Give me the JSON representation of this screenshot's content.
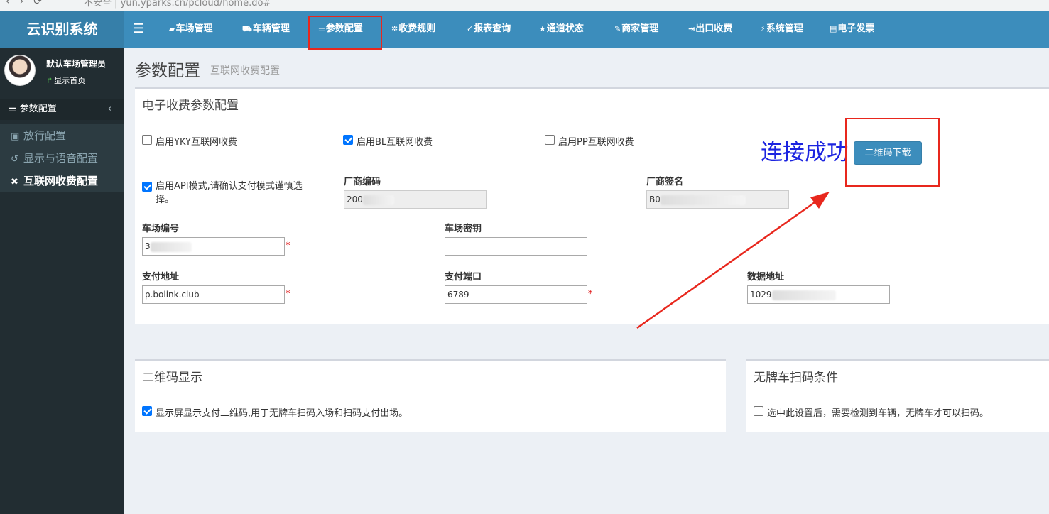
{
  "browser": {
    "url_text": "不安全 | yun.yparks.cn/pcloud/home.do#"
  },
  "header": {
    "logo": "云识别系统",
    "menu": [
      {
        "icon": "car-front-icon",
        "glyph": "▰",
        "label": "车场管理"
      },
      {
        "icon": "car-icon",
        "glyph": "⛟",
        "label": "车辆管理"
      },
      {
        "icon": "sliders-icon",
        "glyph": "⚌",
        "label": "参数配置"
      },
      {
        "icon": "cogs-icon",
        "glyph": "✲",
        "label": "收费规则"
      },
      {
        "icon": "chart-icon",
        "glyph": "✓",
        "label": "报表查询"
      },
      {
        "icon": "star-icon",
        "glyph": "★",
        "label": "通道状态"
      },
      {
        "icon": "tag-icon",
        "glyph": "✎",
        "label": "商家管理"
      },
      {
        "icon": "exit-icon",
        "glyph": "⇥",
        "label": "出口收费"
      },
      {
        "icon": "bolt-icon",
        "glyph": "⚡",
        "label": "系统管理"
      },
      {
        "icon": "invoice-icon",
        "glyph": "▤",
        "label": "电子发票"
      }
    ]
  },
  "sidebar": {
    "user_name": "默认车场管理员",
    "home_link": "显示首页",
    "section": "参数配置",
    "items": [
      {
        "label": "放行配置",
        "glyph": "▣",
        "active": false
      },
      {
        "label": "显示与语音配置",
        "glyph": "↺",
        "active": false
      },
      {
        "label": "互联网收费配置",
        "glyph": "✖",
        "active": true
      }
    ]
  },
  "page": {
    "title": "参数配置",
    "subtitle": "互联网收费配置"
  },
  "echarge": {
    "title": "电子收费参数配置",
    "opt_yky": "启用YKY互联网收费",
    "opt_bl": "启用BL互联网收费",
    "opt_pp": "启用PP互联网收费",
    "opt_api": "启用API模式,请确认支付模式谨慎选择。",
    "vendor_code_label": "厂商编码",
    "vendor_code_value": "200",
    "vendor_sign_label": "厂商签名",
    "vendor_sign_value": "B0",
    "park_no_label": "车场编号",
    "park_no_value": "3",
    "park_key_label": "车场密钥",
    "park_key_value": "",
    "pay_addr_label": "支付地址",
    "pay_addr_value": "p.bolink.club",
    "pay_port_label": "支付端口",
    "pay_port_value": "6789",
    "data_addr_label": "数据地址",
    "data_addr_value": "1029",
    "required_mark": "*",
    "qr_button": "二维码下载",
    "success_text": "连接成功"
  },
  "qr_box": {
    "title": "二维码显示",
    "option": "显示屏显示支付二维码,用于无牌车扫码入场和扫码支付出场。"
  },
  "plate_box": {
    "title": "无牌车扫码条件",
    "option": "选中此设置后，需要检测到车辆，无牌车才可以扫码。"
  },
  "colors": {
    "header": "#3c8dbc",
    "sidebar": "#222d32",
    "highlight_red": "#e8271d",
    "success_blue": "#1c24e0"
  }
}
